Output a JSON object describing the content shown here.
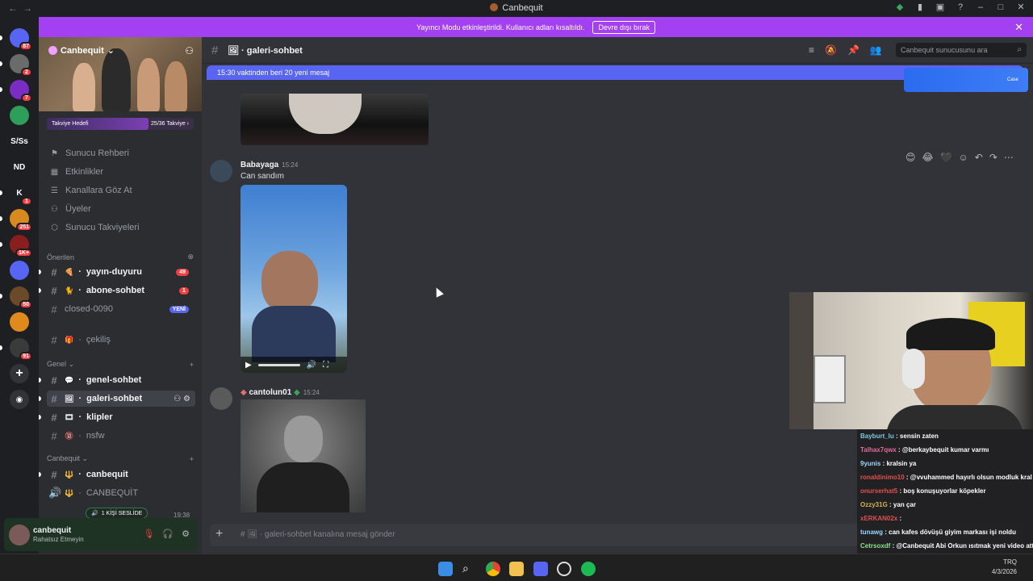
{
  "window": {
    "title": "Canbequit"
  },
  "guilds": [
    {
      "label": "",
      "badge": "87",
      "color": "#5865f2",
      "icon": "discord-home-icon"
    },
    {
      "label": "",
      "badge": "2",
      "color": "#6b6b6b"
    },
    {
      "label": "",
      "badge": "7",
      "color": "#7b2cc4"
    },
    {
      "label": "",
      "badge": "",
      "color": "#2e9e5b"
    },
    {
      "label": "S/Ss",
      "badge": "",
      "color": "#1e1f22"
    },
    {
      "label": "ND",
      "badge": "",
      "color": "#1e1f22"
    },
    {
      "label": "K",
      "badge": "1",
      "color": "#1e1f22"
    },
    {
      "label": "",
      "badge": "251",
      "color": "#d98a1f"
    },
    {
      "label": "",
      "badge": "1K+",
      "color": "#8a1e1e"
    },
    {
      "label": "",
      "badge": "",
      "color": "#5865f2"
    },
    {
      "label": "",
      "badge": "50",
      "color": "#6b4a2a"
    },
    {
      "label": "",
      "badge": "",
      "color": "#e08a1e"
    },
    {
      "label": "",
      "badge": "91",
      "color": "#3a3a3a"
    }
  ],
  "banner": {
    "text": "Yayıncı Modu etkinleştirildi. Kullanıcı adları kısaltıldı.",
    "button": "Devre dışı bırak"
  },
  "server": {
    "name": "Canbequit",
    "boost_label": "Takviye Hedefi",
    "boost_progress": "25/36 Takviye",
    "boost_fraction": 0.694
  },
  "menu": [
    {
      "label": "Sunucu Rehberi",
      "icon": "signpost-icon"
    },
    {
      "label": "Etkinlikler",
      "icon": "calendar-icon"
    },
    {
      "label": "Kanallara Göz At",
      "icon": "browse-icon"
    },
    {
      "label": "Üyeler",
      "icon": "members-icon"
    },
    {
      "label": "Sunucu Takviyeleri",
      "icon": "boost-icon"
    }
  ],
  "categories": {
    "onerilen": "Önerilen",
    "genel": "Genel",
    "canbequit": "Canbequit"
  },
  "channels_recommended": [
    {
      "name": "yayın-duyuru",
      "emoji": "🍕",
      "badge": "49",
      "bold": true
    },
    {
      "name": "abone-sohbet",
      "emoji": "🐈",
      "badge": "1",
      "bold": true
    },
    {
      "name": "closed-0090",
      "emoji": "",
      "new": "YENİ",
      "bold": false
    }
  ],
  "channel_cekilis": {
    "name": "çekiliş",
    "emoji": "🎁"
  },
  "channels_genel": [
    {
      "name": "genel-sohbet",
      "emoji": "💬",
      "bold": true
    },
    {
      "name": "galeri-sohbet",
      "emoji": "🖼",
      "bold": true,
      "active": true
    },
    {
      "name": "klipler",
      "emoji": "🎞",
      "bold": true
    },
    {
      "name": "nsfw",
      "emoji": "🔞",
      "bold": false
    }
  ],
  "channels_canbequit": [
    {
      "name": "canbequit",
      "emoji": "🔱",
      "bold": true,
      "voice": false
    },
    {
      "name": "CANBEQUİT",
      "emoji": "🔱",
      "bold": false,
      "voice": true
    }
  ],
  "voice": {
    "tip": "1 KİŞİ SESLİDE",
    "time": "19:38"
  },
  "user": {
    "name": "canbequit",
    "status": "Rahatsız Etmeyin"
  },
  "header": {
    "channel": "galeri-sohbet",
    "search_placeholder": "Canbequit sunucusunu ara"
  },
  "new_messages": "15:30 vaktinden beri 20 yeni mesaj",
  "messages": [
    {
      "author": "Babayaga",
      "time": "15:24",
      "text": "Can sandım"
    },
    {
      "author": "cantolun01",
      "time": "15:24",
      "text": ""
    }
  ],
  "video_progress": 0.0,
  "composer": {
    "placeholder": "galeri-sohbet kanalına mesaj gönder"
  },
  "ad": {
    "text": "Case"
  },
  "chat_lines": [
    {
      "user": "Bayburt_lu",
      "color": "#7ec8e3",
      "msg": ": sensin zaten"
    },
    {
      "user": "Talhax7qwx",
      "color": "#e06c9f",
      "msg": ": @berkaybequit kumar varmı"
    },
    {
      "user": "9yunis",
      "color": "#9ad6ff",
      "msg": ": kralsin ya"
    },
    {
      "user": "ronaldinimo10",
      "color": "#e05050",
      "msg": ": @vvuhammed hayırlı olsun modluk kral"
    },
    {
      "user": "onurserhat5",
      "color": "#e05050",
      "msg": ": boş konuşuyorlar köpekler"
    },
    {
      "user": "Ozzy31G",
      "color": "#d4b24a",
      "msg": ": yan çar"
    },
    {
      "user": "xERKAN02x",
      "color": "#e05050",
      "msg": ":"
    },
    {
      "user": "tunawg",
      "color": "#9ad6ff",
      "msg": ": can kafes dövüşü giyim markası işi noldu"
    },
    {
      "user": "Cetrsoxdf",
      "color": "#8fe08f",
      "msg": ": @Canbequit Abi Orkun ısıtmak yeni video attı izle lütfen"
    }
  ],
  "taskbar": {
    "clock": "4/3/2026",
    "lang": "TRQ"
  }
}
